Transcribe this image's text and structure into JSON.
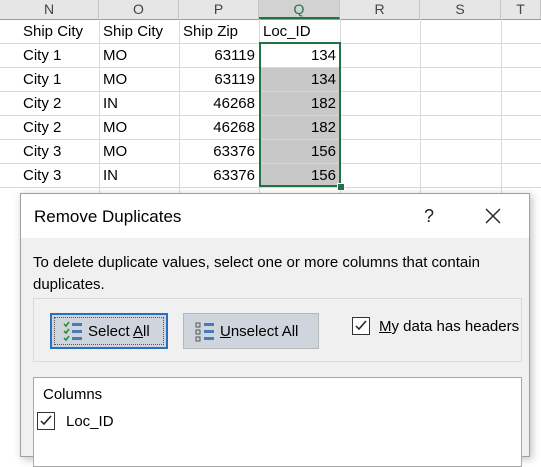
{
  "sheet": {
    "column_headers": [
      "N",
      "O",
      "P",
      "Q",
      "R",
      "S",
      "T"
    ],
    "selected_column": "Q",
    "header_row": [
      "Ship City",
      "Ship City",
      "Ship Zip",
      "Loc_ID"
    ],
    "rows": [
      [
        "City 1",
        "MO",
        "63119",
        "134"
      ],
      [
        "City 1",
        "MO",
        "63119",
        "134"
      ],
      [
        "City 2",
        "IN",
        "46268",
        "182"
      ],
      [
        "City 2",
        "MO",
        "46268",
        "182"
      ],
      [
        "City 3",
        "MO",
        "63376",
        "156"
      ],
      [
        "City 3",
        "IN",
        "63376",
        "156"
      ]
    ],
    "selection_color": "#217346",
    "selected_fill_color": "#c8c8c8"
  },
  "dialog": {
    "title": "Remove Duplicates",
    "help_label": "?",
    "close_icon": "close-icon",
    "description": "To delete duplicate values, select one or more columns that contain duplicates.",
    "select_all_prefix": "Select ",
    "select_all_underlined": "A",
    "select_all_suffix": "ll",
    "unselect_all_underlined": "U",
    "unselect_all_suffix": "nselect All",
    "headers_checkbox_underlined": "M",
    "headers_checkbox_suffix": "y data has headers",
    "headers_checked": true,
    "columns_title": "Columns",
    "columns": [
      {
        "label": "Loc_ID",
        "checked": true
      }
    ]
  }
}
